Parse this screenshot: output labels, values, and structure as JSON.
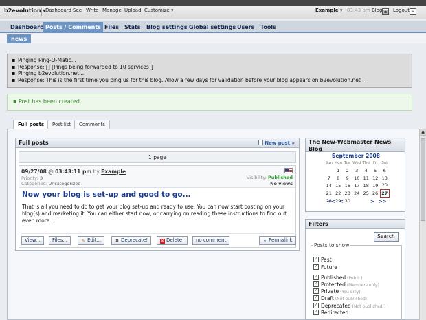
{
  "evobar": {
    "brand": "b2evolution",
    "links": [
      "Dashboard",
      "See",
      "Write",
      "Manage",
      "Upload",
      "Customize"
    ],
    "user": "Example",
    "time": "03:43 pm",
    "blog": "Blog",
    "logout": "Logout"
  },
  "nav": {
    "tabs": [
      "Dashboard",
      "Posts / Comments",
      "Files",
      "Stats",
      "Blog settings",
      "Global settings",
      "Users",
      "Tools"
    ],
    "active": "Posts / Comments",
    "subtab": "news"
  },
  "ping": [
    "Pinging Ping-O-Matic...",
    "Response: [] [Pings being forwarded to 10 services!]",
    "Pinging b2evolution.net...",
    "Response: This is the first time you ping us for this blog. Allow a few days for validation before your blog appears on b2evolution.net ."
  ],
  "success": "Post has been created.",
  "content_tabs": [
    "Full posts",
    "Post list",
    "Comments"
  ],
  "fullposts": {
    "title": "Full posts",
    "new_post": "New post »",
    "pages": "1 page",
    "post": {
      "date": "09/27/08",
      "time_sep": "@",
      "time": "03:43:11 pm",
      "by": "by",
      "author": "Example",
      "priority_label": "Priority:",
      "priority": "3",
      "categories_label": "Categories:",
      "categories": "Uncategorized",
      "visibility_label": "Visibility:",
      "visibility": "Published",
      "views": "No views",
      "title": "Now your blog is set-up and good to go...",
      "body": "That is all you need to do to get your blog set-up and ready to use, You can now start posting on your blog(s) and marketing it. You can either start now, or carrying on reading these instructions to find out even more.",
      "buttons": {
        "view": "View...",
        "files": "Files...",
        "edit": "Edit...",
        "deprecate": "Deprecate!",
        "delete": "Delete!",
        "comment": "no comment",
        "permalink": "Permalink"
      }
    }
  },
  "blog": {
    "title": "The New-Webmaster News Blog",
    "month": "September 2008",
    "weekdays": [
      "Sun",
      "Mon",
      "Tue",
      "Wed",
      "Thu",
      "Fri",
      "Sat"
    ],
    "weeks": [
      [
        "",
        "1",
        "2",
        "3",
        "4",
        "5",
        "6"
      ],
      [
        "7",
        "8",
        "9",
        "10",
        "11",
        "12",
        "13"
      ],
      [
        "14",
        "15",
        "16",
        "17",
        "18",
        "19",
        "20"
      ],
      [
        "21",
        "22",
        "23",
        "24",
        "25",
        "26",
        "27"
      ],
      [
        "28",
        "29",
        "30",
        "",
        "",
        "",
        ""
      ]
    ],
    "today": "27",
    "nav_prev_year": "<<",
    "nav_prev": "<",
    "nav_next": ">",
    "nav_next_year": ">>"
  },
  "filters": {
    "title": "Filters",
    "search": "Search",
    "legend": "Posts to show",
    "items": [
      {
        "label": "Past",
        "hint": ""
      },
      {
        "label": "Future",
        "hint": ""
      },
      {
        "label": "Published",
        "hint": "(Public)"
      },
      {
        "label": "Protected",
        "hint": "(Members only)"
      },
      {
        "label": "Private",
        "hint": "(You only)"
      },
      {
        "label": "Draft",
        "hint": "(Not published!)"
      },
      {
        "label": "Deprecated",
        "hint": "(Not published!)"
      },
      {
        "label": "Redirected",
        "hint": ""
      }
    ]
  }
}
